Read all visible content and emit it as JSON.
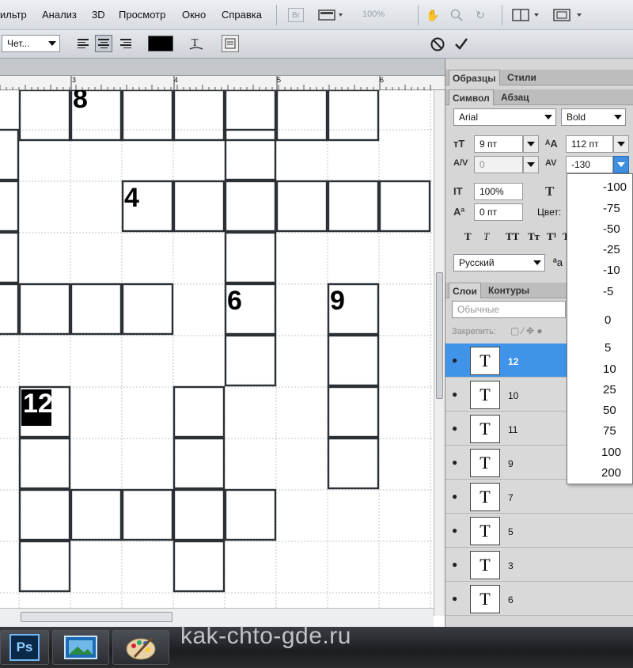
{
  "menu": {
    "items": [
      "ильтр",
      "Анализ",
      "3D",
      "Просмотр",
      "Окно",
      "Справка"
    ],
    "zoom": "100%",
    "icons": [
      "br-icon",
      "screen-mode-icon",
      "hand-tool-icon",
      "zoom-tool-icon",
      "rotate-view-icon",
      "arrange-icon",
      "screen-icon"
    ]
  },
  "options": {
    "font_style": "Чет...",
    "cancel_icon": "cancel-icon",
    "commit_icon": "commit-icon",
    "color_hex": "#000000"
  },
  "canvas": {
    "ruler_labels": [
      "3",
      "4",
      "5",
      "6"
    ],
    "numbers": [
      "8",
      "4",
      "6",
      "9",
      "12"
    ]
  },
  "panel": {
    "top_tabs": [
      "Образцы",
      "Стили"
    ],
    "char_tabs": [
      "Символ",
      "Абзац"
    ],
    "font_family": "Arial",
    "font_style": "Bold",
    "font_size": "9 пт",
    "leading": "112 пт",
    "kerning": "0",
    "tracking": "-130",
    "vscale": "100%",
    "baseline": "0 пт",
    "color_label": "Цвет:",
    "style_buttons": [
      "T",
      "T",
      "TT",
      "Tт",
      "T¹",
      "T"
    ],
    "language": "Русский",
    "aa_label": "ªa",
    "layer_tabs": [
      "Слои",
      "Контуры"
    ],
    "blend_mode": "Обычные",
    "lock_label": "Закрепить:",
    "layers": [
      {
        "name": "12",
        "thumb": "T",
        "selected": true
      },
      {
        "name": "10",
        "thumb": "T"
      },
      {
        "name": "11",
        "thumb": "T"
      },
      {
        "name": "9",
        "thumb": "T"
      },
      {
        "name": "7",
        "thumb": "T"
      },
      {
        "name": "5",
        "thumb": "T"
      },
      {
        "name": "3",
        "thumb": "T"
      },
      {
        "name": "6",
        "thumb": "T"
      }
    ]
  },
  "tracking_dropdown": {
    "options": [
      "-100",
      "-75",
      "-50",
      "-25",
      "-10",
      "-5",
      "0",
      "5",
      "10",
      "25",
      "50",
      "75",
      "100",
      "200"
    ]
  },
  "taskbar": {
    "apps": [
      "Ps",
      "image-viewer-icon",
      "paint-icon"
    ],
    "watermark": "kak-chto-gde.ru"
  }
}
